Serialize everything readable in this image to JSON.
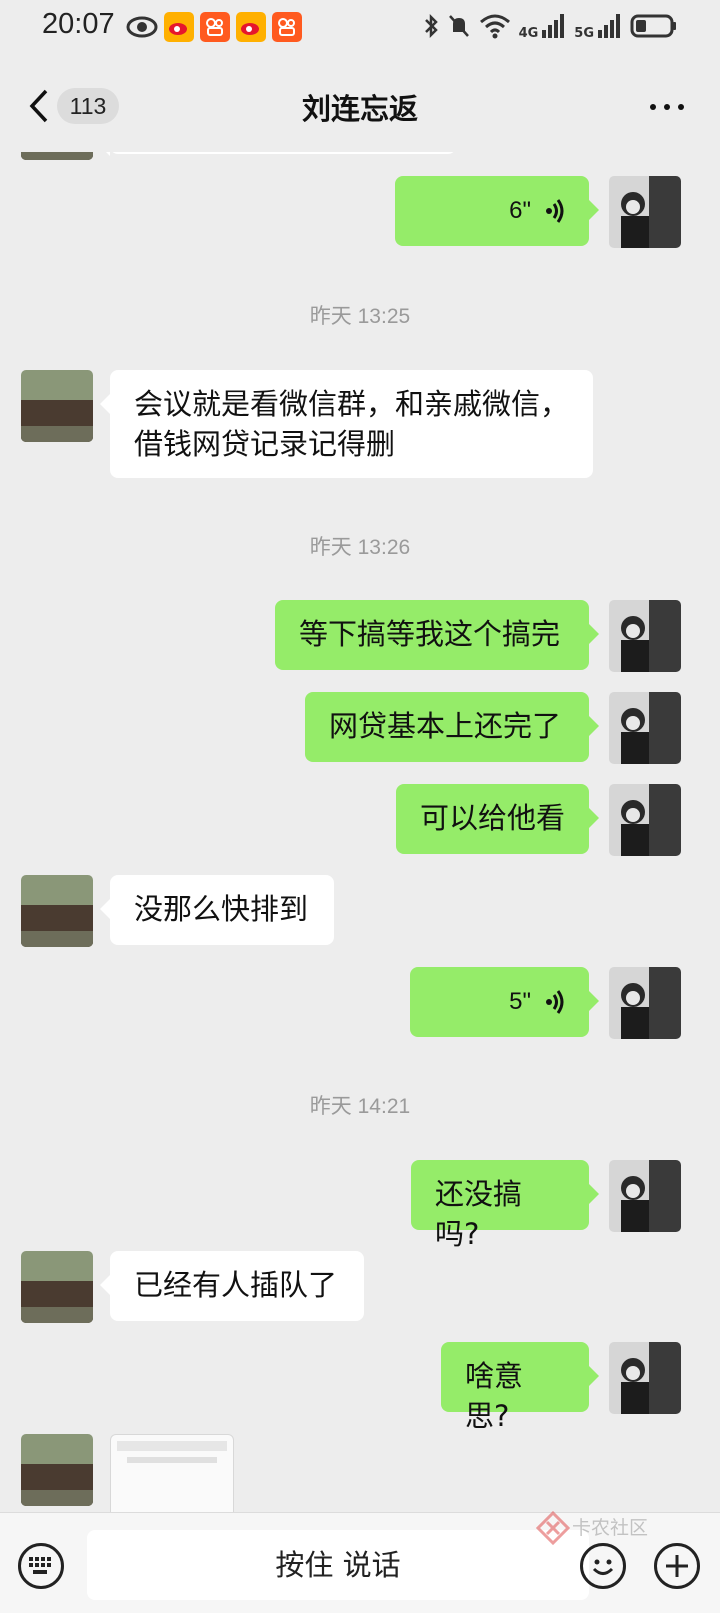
{
  "status_bar": {
    "time": "20:07",
    "net1": "4G",
    "net2": "5G",
    "icons": [
      "eye-icon",
      "weibo-icon",
      "kuaishou-icon",
      "weibo-icon",
      "kuaishou-icon",
      "bluetooth-icon",
      "mute-icon",
      "wifi-icon",
      "signal-icon",
      "signal-icon",
      "battery-icon"
    ]
  },
  "header": {
    "unread_count": "113",
    "title": "刘连忘返"
  },
  "messages": [
    {
      "id": "v1",
      "from": "me",
      "type": "voice",
      "duration": "6\""
    },
    {
      "id": "t1",
      "type": "time",
      "text": "昨天 13:25"
    },
    {
      "id": "m1",
      "from": "them",
      "type": "text",
      "text": "会议就是看微信群，和亲戚微信，借钱网贷记录记得删"
    },
    {
      "id": "t2",
      "type": "time",
      "text": "昨天 13:26"
    },
    {
      "id": "m2",
      "from": "me",
      "type": "text",
      "text": "等下搞等我这个搞完"
    },
    {
      "id": "m3",
      "from": "me",
      "type": "text",
      "text": "网贷基本上还完了"
    },
    {
      "id": "m4",
      "from": "me",
      "type": "text",
      "text": "可以给他看"
    },
    {
      "id": "m5",
      "from": "them",
      "type": "text",
      "text": "没那么快排到"
    },
    {
      "id": "v2",
      "from": "me",
      "type": "voice",
      "duration": "5\""
    },
    {
      "id": "t3",
      "type": "time",
      "text": "昨天 14:21"
    },
    {
      "id": "m6",
      "from": "me",
      "type": "text",
      "text": "还没搞吗?"
    },
    {
      "id": "m7",
      "from": "them",
      "type": "text",
      "text": "已经有人插队了"
    },
    {
      "id": "m8",
      "from": "me",
      "type": "text",
      "text": "啥意思?"
    }
  ],
  "m1_lines": [
    "会议就是看微信群，和亲戚微信，",
    "借钱网贷记录记得删"
  ],
  "bottom": {
    "hold_to_talk": "按住 说话",
    "watermark": "卡农社区"
  }
}
